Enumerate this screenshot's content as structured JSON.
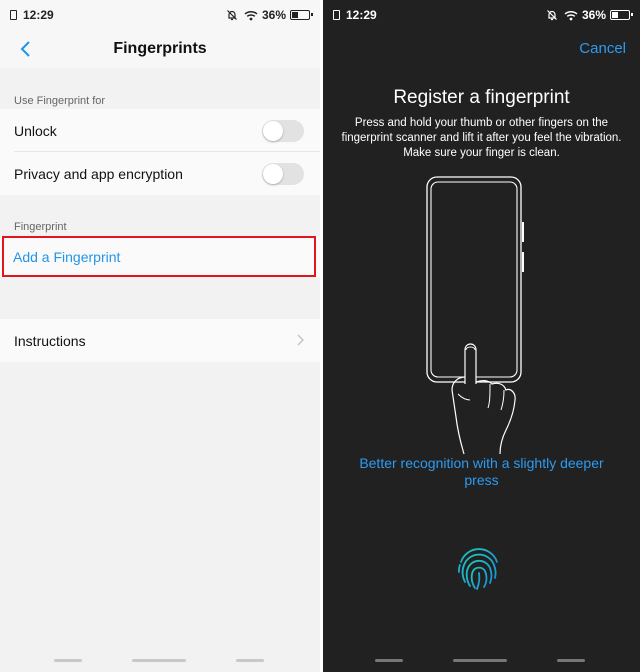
{
  "left": {
    "status": {
      "time": "12:29",
      "battery": "36%"
    },
    "header": {
      "title": "Fingerprints"
    },
    "section_use": "Use Fingerprint for",
    "unlock_label": "Unlock",
    "privacy_label": "Privacy and app encryption",
    "section_fingerprint": "Fingerprint",
    "add_label": "Add a Fingerprint",
    "instructions_label": "Instructions"
  },
  "right": {
    "status": {
      "time": "12:29",
      "battery": "36%"
    },
    "cancel_label": "Cancel",
    "title": "Register a fingerprint",
    "description": "Press and hold your thumb or other fingers on the fingerprint scanner and lift it after you feel the vibration. Make sure your finger is clean.",
    "hint": "Better recognition with a slightly deeper press"
  },
  "colors": {
    "accent_blue": "#2196e8",
    "highlight_red": "#e0151d",
    "dark_bg": "#212121",
    "fingerprint_teal": "#1ec8c0"
  }
}
